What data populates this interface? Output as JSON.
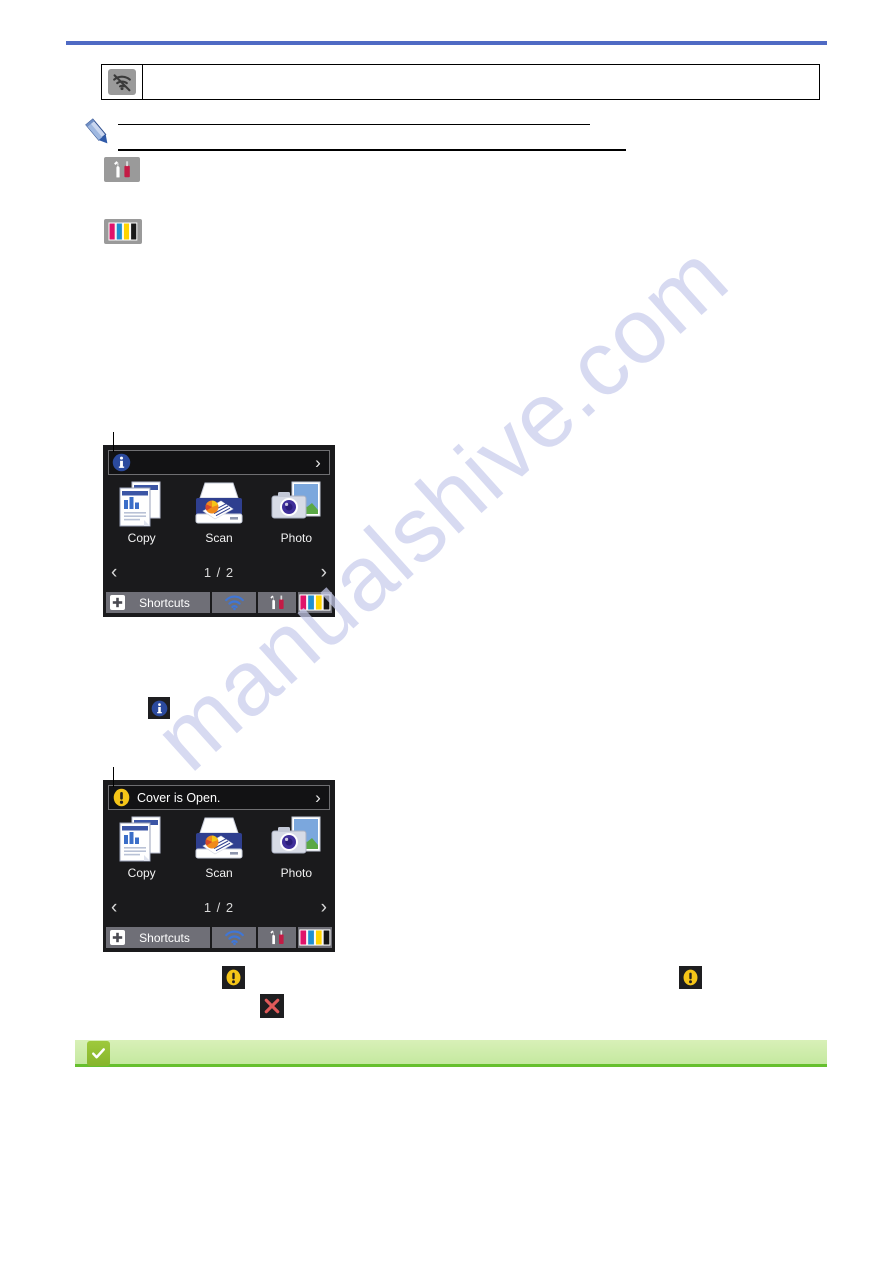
{
  "page": {
    "watermark_text": "manualshive.com"
  },
  "wifi_table": {
    "icon_name": "wifi-off-icon",
    "text": ""
  },
  "note": {
    "icon_name": "pencil-note-icon",
    "line1_text": "",
    "line2_text": ""
  },
  "inline_icons": {
    "settings": {
      "name": "settings-wrench-screwdriver-icon",
      "label": ""
    },
    "ink": {
      "name": "ink-levels-icon",
      "label": "",
      "cartridge_colors": [
        "#e0126a",
        "#1e8fd0",
        "#ffd400",
        "#1a1a1a"
      ]
    }
  },
  "lcd_screens": [
    {
      "id": "lcd-info",
      "banner": {
        "icon_name": "info-icon",
        "text": "",
        "chevron": "›"
      },
      "apps": [
        {
          "label": "Copy",
          "icon_name": "copy-icon"
        },
        {
          "label": "Scan",
          "icon_name": "scan-icon"
        },
        {
          "label": "Photo",
          "icon_name": "photo-icon"
        }
      ],
      "pager": {
        "prev": "‹",
        "label": "1 / 2",
        "next": "›"
      },
      "taskbar": {
        "shortcuts_label": "Shortcuts",
        "plus_glyph": "✚",
        "wifi_name": "wifi-icon",
        "settings_name": "settings-icon",
        "ink_name": "ink-icon"
      }
    },
    {
      "id": "lcd-cover-open",
      "banner": {
        "icon_name": "warning-icon",
        "text": "Cover is Open.",
        "chevron": "›"
      },
      "apps": [
        {
          "label": "Copy",
          "icon_name": "copy-icon"
        },
        {
          "label": "Scan",
          "icon_name": "scan-icon"
        },
        {
          "label": "Photo",
          "icon_name": "photo-icon"
        }
      ],
      "pager": {
        "prev": "‹",
        "label": "1 / 2",
        "next": "›"
      },
      "taskbar": {
        "shortcuts_label": "Shortcuts",
        "plus_glyph": "✚",
        "wifi_name": "wifi-icon",
        "settings_name": "settings-icon",
        "ink_name": "ink-icon"
      }
    }
  ],
  "standalone_icons": [
    {
      "name": "info-icon",
      "label": ""
    },
    {
      "name": "warning-icon",
      "label": ""
    },
    {
      "name": "warning-icon",
      "label": ""
    },
    {
      "name": "error-cross-icon",
      "label": ""
    }
  ],
  "tip": {
    "icon_name": "check-icon",
    "text": ""
  },
  "colors": {
    "top_rule": "#4f6ac4",
    "lcd_background": "#1a1a1c",
    "taskbar_cell": "#6f6f77",
    "tip_green": "#c5e9a0",
    "tip_border": "#66c02e",
    "warning_yellow": "#f5c518",
    "info_blue": "#2b4a9e",
    "error_red": "#e05a5a"
  }
}
